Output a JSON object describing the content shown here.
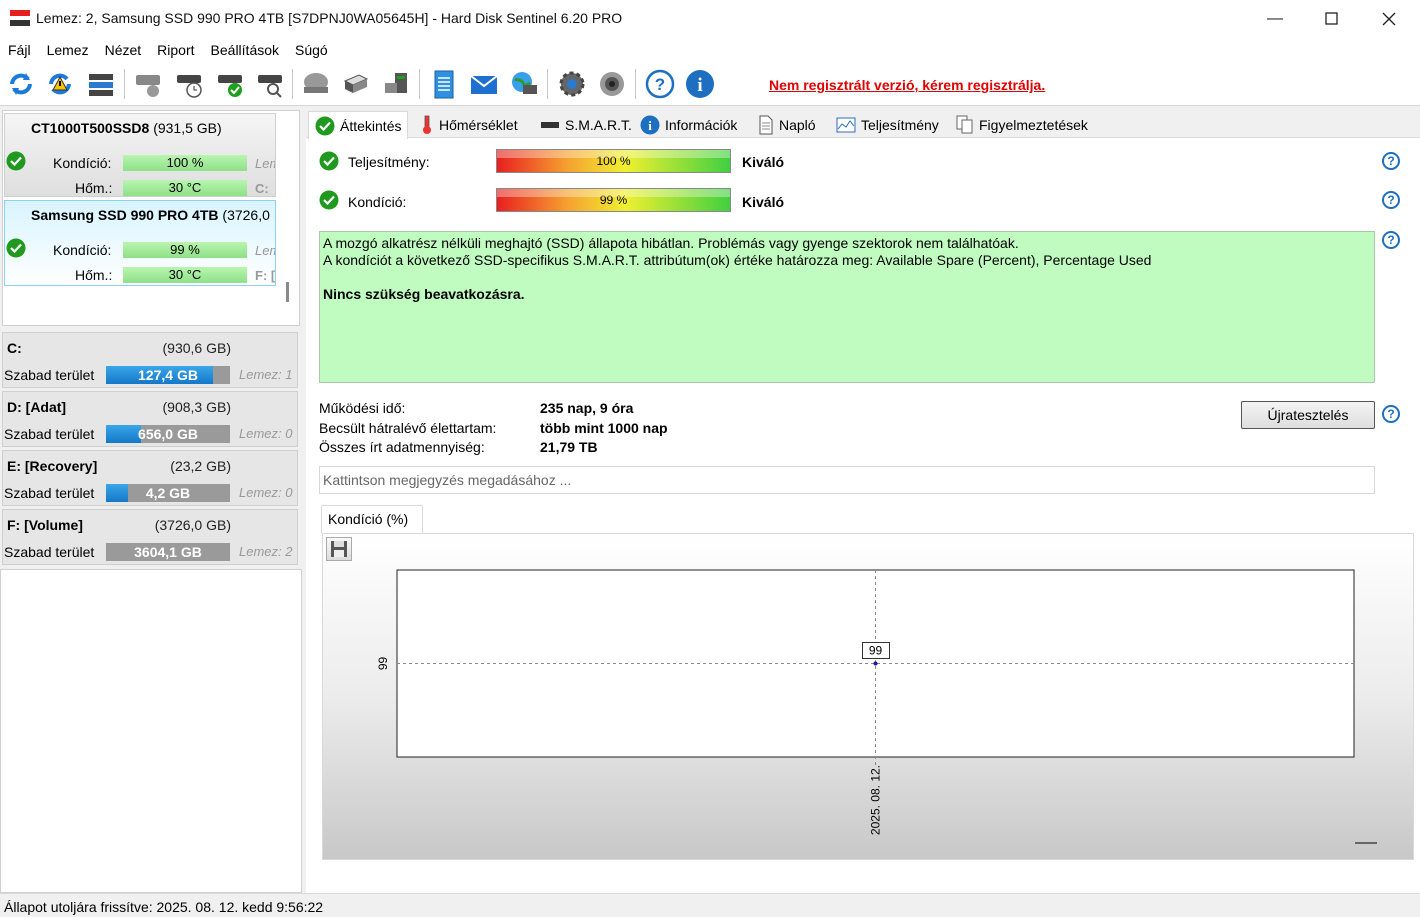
{
  "window": {
    "title": "Lemez: 2, Samsung SSD 990 PRO 4TB [S7DPNJ0WA05645H]  -  Hard Disk Sentinel 6.20 PRO"
  },
  "menu": [
    "Fájl",
    "Lemez",
    "Nézet",
    "Riport",
    "Beállítások",
    "Súgó"
  ],
  "toolbar": {
    "icons": [
      "refresh-icon",
      "refresh-warning-icon",
      "disk-list-icon",
      "disk-gray-icon",
      "disk-clock-icon",
      "disk-check-icon",
      "disk-search-icon",
      "disk-dome-icon",
      "usb-icon",
      "network-disk-icon",
      "notepad-icon",
      "mail-icon",
      "globe-monitor-icon",
      "gear-icon",
      "speaker-icon",
      "help-icon",
      "info-icon"
    ],
    "register_text": "Nem regisztrált verzió, kérem regisztrálja."
  },
  "disks": [
    {
      "name": "CT1000T500SSD8",
      "size": "(931,5 GB)",
      "condition_label": "Kondíció:",
      "condition": "100 %",
      "temp_label": "Hőm.:",
      "temp": "30 °C",
      "clip_top": "Lem",
      "clip_bottom": "C:",
      "selected": false
    },
    {
      "name": "Samsung SSD 990 PRO 4TB",
      "size": "(3726,0",
      "condition_label": "Kondíció:",
      "condition": "99 %",
      "temp_label": "Hőm.:",
      "temp": "30 °C",
      "clip_top": "Lem",
      "clip_bottom": "F: [V",
      "selected": true
    }
  ],
  "partitions": [
    {
      "name": "C:",
      "size": "(930,6 GB)",
      "free_label": "Szabad terület",
      "free": "127,4 GB",
      "free_fraction": 0.137,
      "clip": "Lemez: 1"
    },
    {
      "name": "D: [Adat]",
      "size": "(908,3 GB)",
      "free_label": "Szabad terület",
      "free": "656,0 GB",
      "free_fraction": 0.72,
      "clip": "Lemez: 0"
    },
    {
      "name": "E: [Recovery]",
      "size": "(23,2 GB)",
      "free_label": "Szabad terület",
      "free": "4,2 GB",
      "free_fraction": 0.82,
      "clip": "Lemez: 0"
    },
    {
      "name": "F: [Volume]",
      "size": "(3726,0 GB)",
      "free_label": "Szabad terület",
      "free": "3604,1 GB",
      "free_fraction": 0.0,
      "clip": "Lemez: 2"
    }
  ],
  "tabs": [
    "Áttekintés",
    "Hőmérséklet",
    "S.M.A.R.T.",
    "Információk",
    "Napló",
    "Teljesítmény",
    "Figyelmeztetések"
  ],
  "overview": {
    "performance_label": "Teljesítmény:",
    "performance_value": "100 %",
    "performance_rating": "Kiváló",
    "condition_label": "Kondíció:",
    "condition_value": "99 %",
    "condition_rating": "Kiváló",
    "message_line1": "A mozgó alkatrész nélküli meghajtó (SSD) állapota hibátlan. Problémás vagy gyenge szektorok nem találhatóak.",
    "message_line2": "A kondíciót a következő SSD-specifikus S.M.A.R.T. attribútum(ok) értéke határozza meg:  Available Spare (Percent), Percentage Used",
    "message_bold": "Nincs szükség beavatkozásra.",
    "uptime_label": "Működési idő:",
    "uptime_value": "235 nap, 9 óra",
    "lifetime_label": "Becsült hátralévő élettartam:",
    "lifetime_value": "több mint 1000 nap",
    "written_label": "Összes írt adatmennyiség:",
    "written_value": "21,79 TB",
    "retest_button": "Újratesztelés",
    "note_placeholder": "Kattintson megjegyzés megadásához ..."
  },
  "chart_tab": "Kondíció  (%)",
  "chart_data": {
    "type": "line",
    "x": [
      "2025. 08. 12."
    ],
    "series": [
      {
        "values": [
          99
        ]
      }
    ],
    "y_tick_labels": [
      "99"
    ],
    "x_tick_labels": [
      "2025. 08. 12."
    ],
    "data_labels": [
      "99"
    ]
  },
  "status": {
    "text": "Állapot utoljára frissítve: 2025. 08. 12. kedd 9:56:22"
  }
}
